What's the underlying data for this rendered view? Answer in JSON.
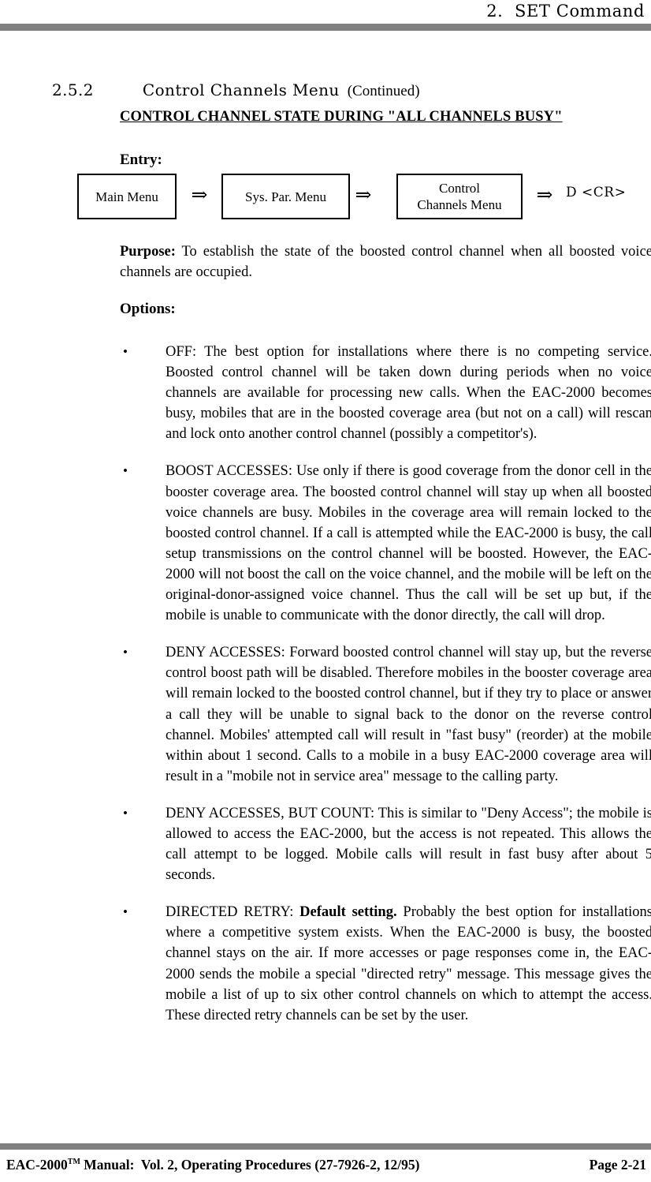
{
  "header": {
    "running_head": "2.  SET Command"
  },
  "section": {
    "number": "2.5.2",
    "title": "Control Channels Menu",
    "continued": "(Continued)"
  },
  "topic_title": "CONTROL CHANNEL STATE DURING \"ALL CHANNELS BUSY\"",
  "entry": {
    "label": "Entry:",
    "boxes": [
      {
        "line1": "Main Menu",
        "line2": ""
      },
      {
        "line1": "Sys. Par. Menu",
        "line2": ""
      },
      {
        "line1": "Control",
        "line2": "Channels Menu"
      }
    ],
    "arrow": "⇒",
    "command": "D <CR>"
  },
  "purpose": {
    "label": "Purpose:",
    "text": "  To establish the state of the boosted control channel when all boosted voice channels are occupied."
  },
  "options": {
    "label": "Options:",
    "bullet_glyph": "•",
    "items": [
      {
        "name": "off",
        "text": "OFF:   The best option for installations where there is no competing service. Boosted control channel will be taken down during periods when no voice channels are available for processing new calls.  When the EAC-2000 becomes busy, mobiles that are in the boosted coverage area (but not on a call) will rescan and lock onto another control channel (possibly a competitor's).",
        "emphasis": ""
      },
      {
        "name": "boost-accesses",
        "text": "BOOST ACCESSES:  Use only if there is good coverage from the donor cell in the booster coverage area.  The boosted control channel will stay up when all boosted voice channels are busy.  Mobiles in the coverage area will remain locked to the boosted control channel.  If a call is attempted while the EAC-2000 is busy, the call setup transmissions on the control channel will be boosted.  However, the EAC-2000 will not boost the call on the voice channel, and the mobile will be left on the original-donor-assigned voice channel.  Thus the call will be set up but, if the mobile is unable to communicate with the donor directly, the call will drop.",
        "emphasis": ""
      },
      {
        "name": "deny-accesses",
        "text": "DENY ACCESSES:  Forward boosted control channel will stay up, but the reverse control boost path will be disabled.  Therefore mobiles in the booster coverage area will remain locked to the boosted control channel, but if they try to place or answer a call they will be unable to signal back to the donor on the reverse control channel.  Mobiles' attempted call will result in \"fast busy\" (reorder) at the mobile within about 1 second.  Calls to a mobile in a busy EAC-2000 coverage area will result in a \"mobile not in service area\" message to the calling party.",
        "emphasis": ""
      },
      {
        "name": "deny-accesses-but-count",
        "text": "DENY ACCESSES, BUT COUNT:  This is similar to \"Deny Access\"; the mobile is allowed to access the EAC-2000, but the access is not repeated.  This allows the call attempt to be logged.  Mobile calls will result in fast busy after about 5 seconds.",
        "emphasis": ""
      },
      {
        "name": "directed-retry",
        "prefix": "DIRECTED RETRY:  ",
        "emphasis": "Default setting.",
        "text": "  Probably the best option for installations where a competitive system exists.  When the EAC-2000 is busy, the boosted channel stays on the air.  If more accesses or page responses come in, the EAC-2000 sends the mobile a special \"directed retry\" message.  This message gives the mobile a list of up to six other control channels on which to attempt the access.  These directed retry channels can be set by the user."
      }
    ]
  },
  "footer": {
    "product": "EAC-2000",
    "trademark": "TM",
    "left_rest": " Manual:  Vol. 2, Operating Procedures (27-7926-2, 12/95)",
    "page": "Page 2-21"
  },
  "colors": {
    "rule": "#808080",
    "text": "#000000",
    "background": "#ffffff"
  }
}
